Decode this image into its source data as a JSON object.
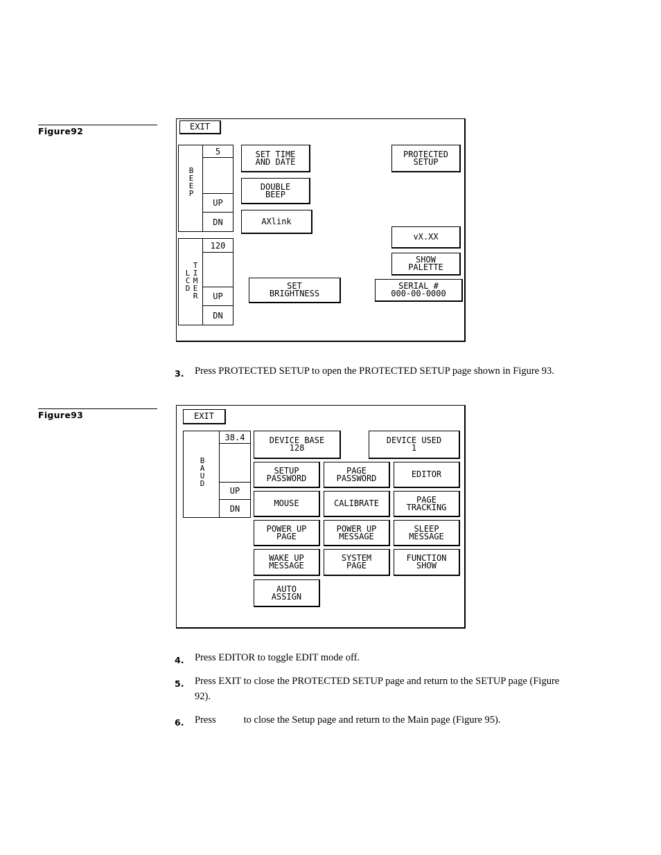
{
  "figure92": {
    "label": "Figure92",
    "exit": "EXIT",
    "beep": {
      "label": "BEEP",
      "value": "5",
      "up": "UP",
      "dn": "DN"
    },
    "lcd_timer": {
      "label_left": "LCD",
      "label_right": "TIMER",
      "value": "120",
      "up": "UP",
      "dn": "DN"
    },
    "buttons": {
      "set_time_and_date": [
        "SET TIME",
        "AND DATE"
      ],
      "double_beep": [
        "DOUBLE",
        "BEEP"
      ],
      "axlink": [
        "AXlink"
      ],
      "set_brightness": [
        "SET",
        "BRIGHTNESS"
      ],
      "protected_setup": [
        "PROTECTED",
        "SETUP"
      ],
      "version": [
        "vX.XX"
      ],
      "show_palette": [
        "SHOW",
        "PALETTE"
      ],
      "serial": [
        "SERIAL #",
        "000-00-0000"
      ]
    }
  },
  "step3": {
    "num": "3.",
    "text": "Press PROTECTED SETUP to open the PROTECTED SETUP page shown in Figure 93."
  },
  "figure93": {
    "label": "Figure93",
    "exit": "EXIT",
    "baud": {
      "label": "BAUD",
      "value": "38.4",
      "up": "UP",
      "dn": "DN"
    },
    "buttons": {
      "device_base": [
        "DEVICE BASE",
        "128"
      ],
      "device_used": [
        "DEVICE USED",
        "1"
      ],
      "setup_password": [
        "SETUP",
        "PASSWORD"
      ],
      "page_password": [
        "PAGE",
        "PASSWORD"
      ],
      "editor": [
        "EDITOR"
      ],
      "mouse": [
        "MOUSE"
      ],
      "calibrate": [
        "CALIBRATE"
      ],
      "page_tracking": [
        "PAGE",
        "TRACKING"
      ],
      "power_up_page": [
        "POWER UP",
        "PAGE"
      ],
      "power_up_message": [
        "POWER UP",
        "MESSAGE"
      ],
      "sleep_message": [
        "SLEEP",
        "MESSAGE"
      ],
      "wake_up_message": [
        "WAKE UP",
        "MESSAGE"
      ],
      "system_page": [
        "SYSTEM",
        "PAGE"
      ],
      "function_show": [
        "FUNCTION",
        "SHOW"
      ],
      "auto_assign": [
        "AUTO",
        "ASSIGN"
      ]
    }
  },
  "steps": [
    {
      "num": "4.",
      "text": "Press EDITOR to toggle EDIT mode off."
    },
    {
      "num": "5.",
      "text": "Press EXIT to close the PROTECTED SETUP page and return to the SETUP page (Figure 92)."
    },
    {
      "num": "6.",
      "text_before": "Press",
      "text_after": "to close the Setup page and return to the Main page (Figure 95)."
    }
  ]
}
